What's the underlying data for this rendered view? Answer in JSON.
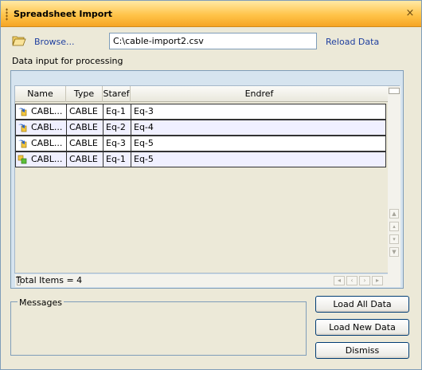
{
  "window": {
    "title": "Spreadsheet Import",
    "close_glyph": "×"
  },
  "toolbar": {
    "browse_label": "Browse...",
    "browse_icon": "folder-open-icon",
    "file_path": "C:\\cable-import2.csv",
    "reload_label": "Reload Data"
  },
  "data_label": "Data input for processing",
  "grid": {
    "columns": [
      "Name",
      "Type",
      "Staref",
      "Endref"
    ],
    "rows": [
      {
        "name": "CABL...",
        "type": "CABLE",
        "staref": "Eq-1",
        "endref": "Eq-3",
        "icon": "import-arrow-icon"
      },
      {
        "name": "CABL...",
        "type": "CABLE",
        "staref": "Eq-2",
        "endref": "Eq-4",
        "icon": "import-arrow-icon"
      },
      {
        "name": "CABL...",
        "type": "CABLE",
        "staref": "Eq-3",
        "endref": "Eq-5",
        "icon": "import-arrow-icon"
      },
      {
        "name": "CABL...",
        "type": "CABLE",
        "staref": "Eq-1",
        "endref": "Eq-5",
        "icon": "new-item-icon"
      }
    ],
    "total": "Total Items = 4"
  },
  "messages": {
    "label": "Messages"
  },
  "buttons": {
    "load_all": "Load All Data",
    "load_new": "Load New Data",
    "dismiss": "Dismiss"
  },
  "colors": {
    "title_bar": "#ffc44a",
    "link": "#1f3f9f",
    "alt_row": "#f0f0ff"
  }
}
